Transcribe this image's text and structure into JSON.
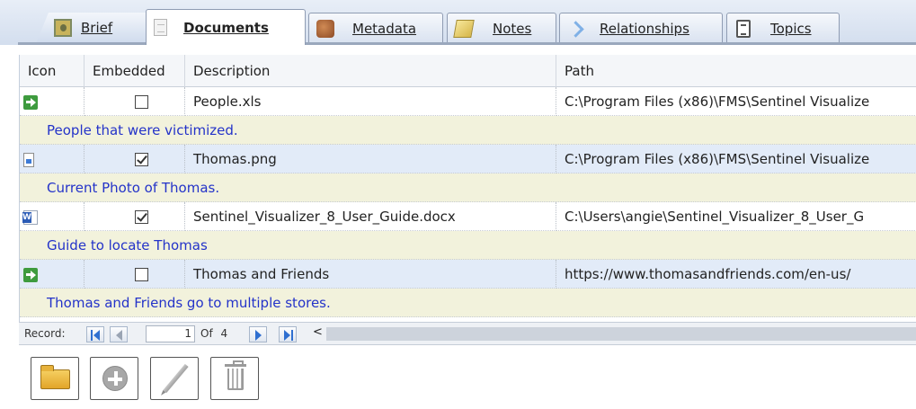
{
  "tabs": [
    {
      "id": "brief",
      "label": "Brief",
      "icon": "person-photo-icon"
    },
    {
      "id": "documents",
      "label": "Documents",
      "icon": "document-icon",
      "active": true
    },
    {
      "id": "metadata",
      "label": "Metadata",
      "icon": "metadata-icon"
    },
    {
      "id": "notes",
      "label": "Notes",
      "icon": "notes-icon"
    },
    {
      "id": "relationships",
      "label": "Relationships",
      "icon": "relationships-arrow-icon"
    },
    {
      "id": "topics",
      "label": "Topics",
      "icon": "topics-icon"
    }
  ],
  "grid": {
    "columns": {
      "icon": "Icon",
      "embedded": "Embedded",
      "description": "Description",
      "path": "Path"
    },
    "rows": [
      {
        "icon": "link-arrow-icon",
        "embedded": false,
        "name": "People.xls",
        "path": "C:\\Program Files (x86)\\FMS\\Sentinel Visualize",
        "note": "People that were victimized.",
        "selected": false
      },
      {
        "icon": "image-file-icon",
        "embedded": true,
        "name": "Thomas.png",
        "path": "C:\\Program Files (x86)\\FMS\\Sentinel Visualize",
        "note": "Current Photo of Thomas.",
        "selected": true
      },
      {
        "icon": "word-document-icon",
        "embedded": true,
        "name": "Sentinel_Visualizer_8_User_Guide.docx",
        "path": "C:\\Users\\angie\\Sentinel_Visualizer_8_User_G",
        "note": "Guide to locate Thomas",
        "selected": false
      },
      {
        "icon": "link-arrow-icon",
        "embedded": false,
        "name": "Thomas and Friends",
        "path": "https://www.thomasandfriends.com/en-us/",
        "note": "Thomas and Friends go to multiple stores.",
        "selected": true
      }
    ]
  },
  "navigator": {
    "label": "Record:",
    "current": "1",
    "of_label": "Of",
    "total": "4"
  },
  "toolbar": [
    {
      "id": "open",
      "icon": "open-folder-icon"
    },
    {
      "id": "add",
      "icon": "add-circle-icon"
    },
    {
      "id": "edit",
      "icon": "pencil-icon"
    },
    {
      "id": "delete",
      "icon": "trash-icon"
    }
  ],
  "colors": {
    "selected_row": "#e2ebf8",
    "description_band": "#f2f2dc",
    "description_text": "#2433c9"
  }
}
